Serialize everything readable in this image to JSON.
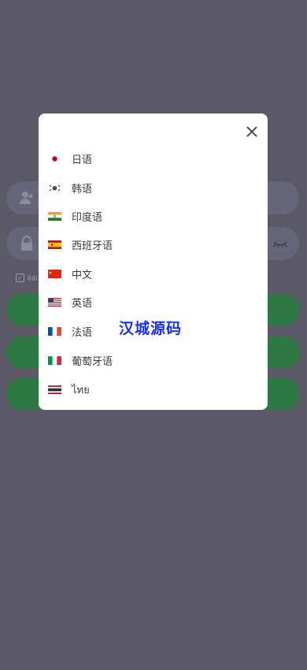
{
  "login": {
    "remember_label": "จด"
  },
  "language_dialog": {
    "close_icon": "close-icon",
    "languages": [
      {
        "label": "日语",
        "flag": "japan-flag-icon"
      },
      {
        "label": "韩语",
        "flag": "korea-flag-icon"
      },
      {
        "label": "印度语",
        "flag": "india-flag-icon"
      },
      {
        "label": "西班牙语",
        "flag": "spain-flag-icon"
      },
      {
        "label": "中文",
        "flag": "china-flag-icon"
      },
      {
        "label": "英语",
        "flag": "usa-flag-icon"
      },
      {
        "label": "法语",
        "flag": "france-flag-icon"
      },
      {
        "label": "葡萄牙语",
        "flag": "italy-flag-icon"
      },
      {
        "label": "ไทย",
        "flag": "thailand-flag-icon"
      }
    ]
  },
  "watermark": "汉城源码",
  "colors": {
    "overlay": "#5a5a66",
    "button_green": "#2e7a44",
    "watermark": "#1a2ff0"
  }
}
